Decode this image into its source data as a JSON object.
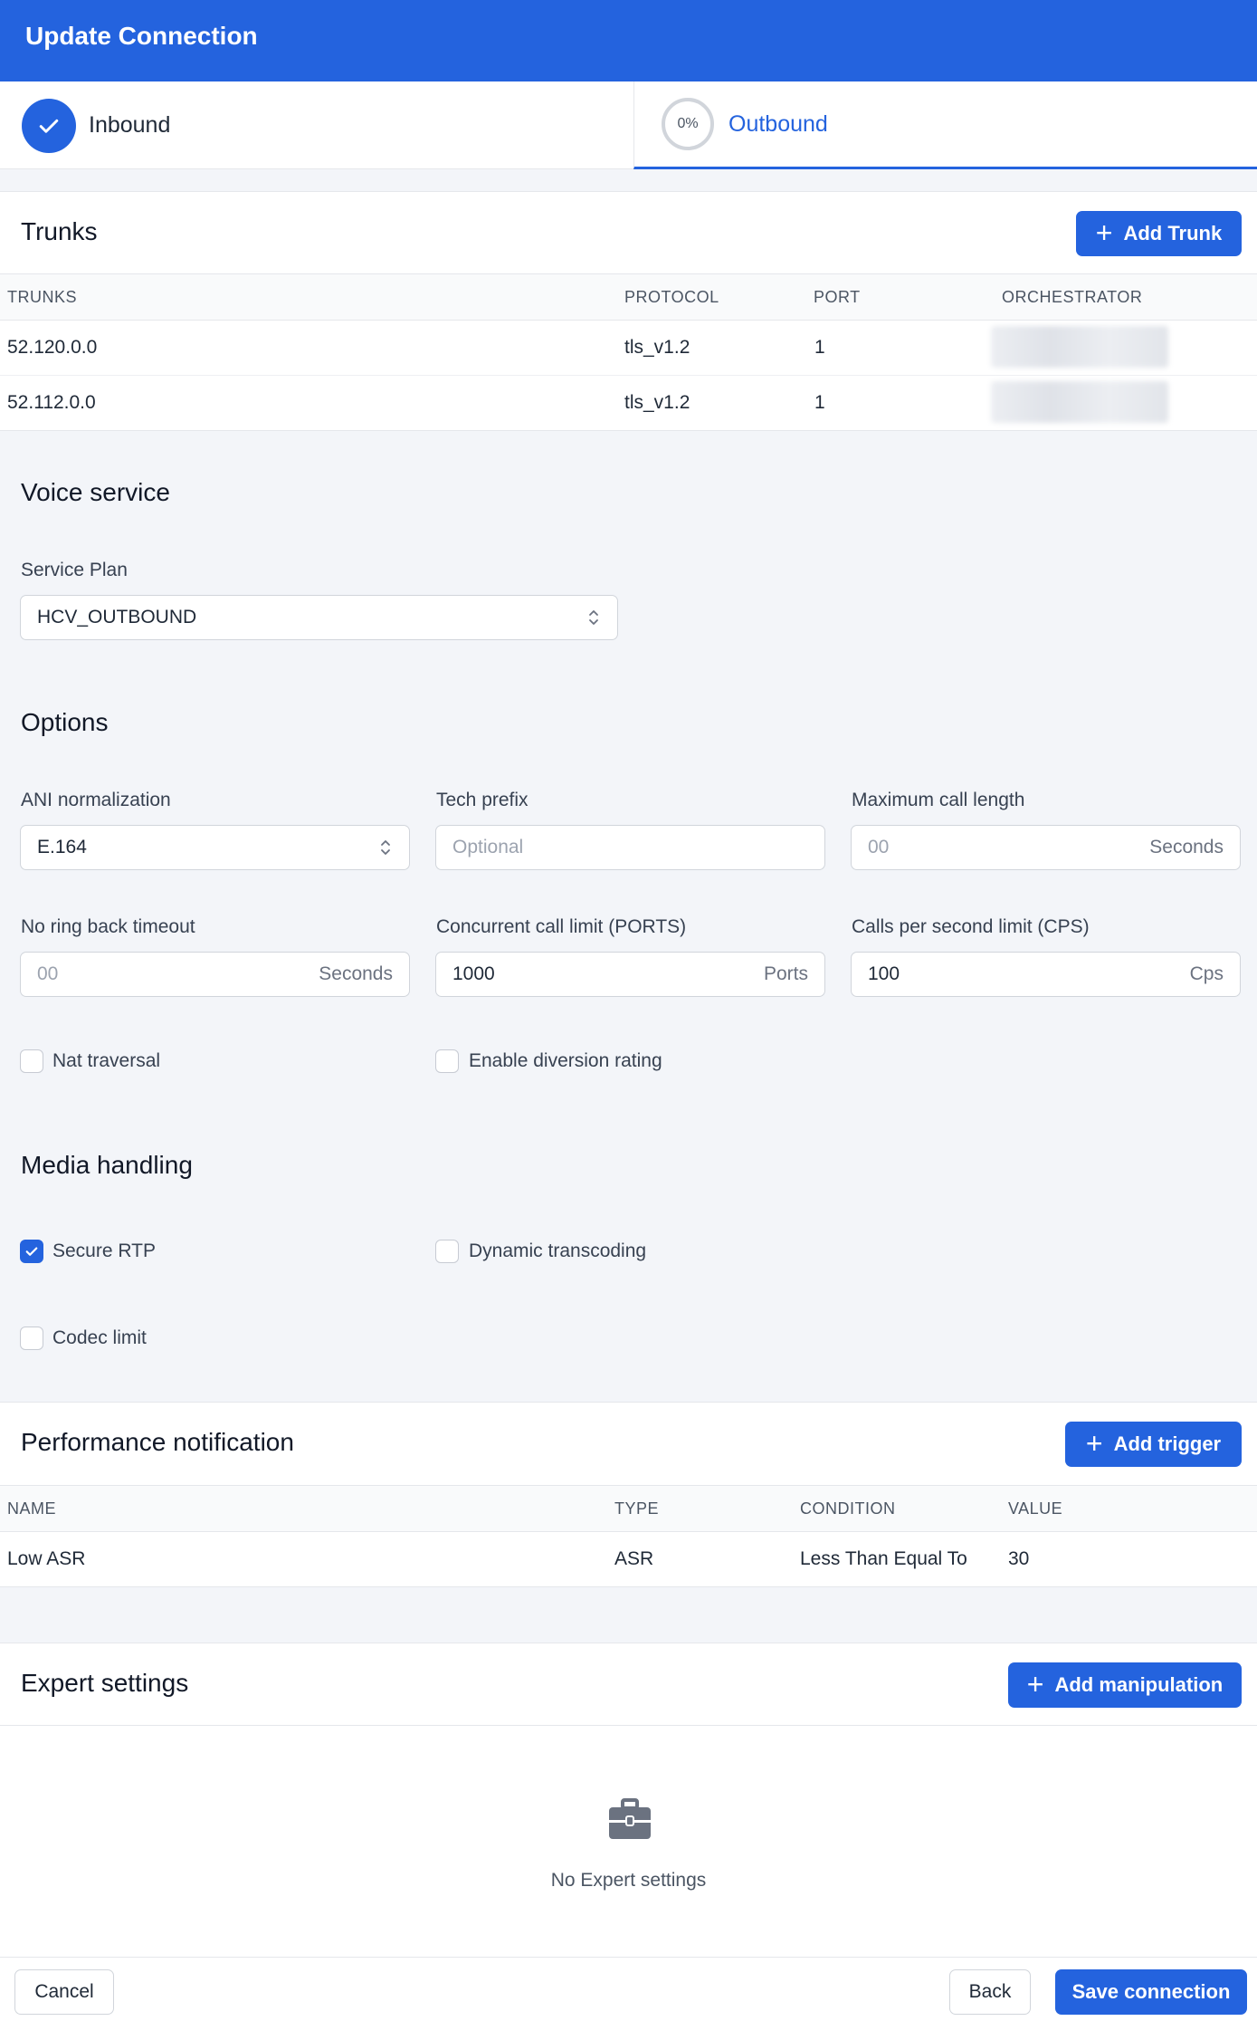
{
  "header": {
    "title": "Update Connection"
  },
  "steps": [
    {
      "label": "Inbound",
      "state": "complete"
    },
    {
      "label": "Outbound",
      "progress": "0%",
      "state": "active"
    }
  ],
  "trunks": {
    "title": "Trunks",
    "add_label": "Add Trunk",
    "columns": [
      "TRUNKS",
      "PROTOCOL",
      "PORT",
      "ORCHESTRATOR"
    ],
    "rows": [
      {
        "trunk": "52.120.0.0",
        "protocol": "tls_v1.2",
        "port": "1"
      },
      {
        "trunk": "52.112.0.0",
        "protocol": "tls_v1.2",
        "port": "1"
      }
    ]
  },
  "voice_service": {
    "title": "Voice service",
    "service_plan_label": "Service Plan",
    "service_plan_value": "HCV_OUTBOUND"
  },
  "options": {
    "title": "Options",
    "ani_label": "ANI normalization",
    "ani_value": "E.164",
    "tech_prefix_label": "Tech prefix",
    "tech_prefix_placeholder": "Optional",
    "max_call_label": "Maximum call length",
    "max_call_placeholder": "00",
    "max_call_suffix": "Seconds",
    "no_ring_label": "No ring back timeout",
    "no_ring_placeholder": "00",
    "no_ring_suffix": "Seconds",
    "concurrent_label": "Concurrent call limit (PORTS)",
    "concurrent_value": "1000",
    "concurrent_suffix": "Ports",
    "cps_label": "Calls per second limit (CPS)",
    "cps_value": "100",
    "cps_suffix": "Cps",
    "nat_label": "Nat traversal",
    "diversion_label": "Enable diversion rating"
  },
  "media": {
    "title": "Media handling",
    "secure_rtp_label": "Secure RTP",
    "dynamic_label": "Dynamic transcoding",
    "codec_label": "Codec limit"
  },
  "performance": {
    "title": "Performance notification",
    "add_label": "Add trigger",
    "columns": [
      "NAME",
      "TYPE",
      "CONDITION",
      "VALUE"
    ],
    "rows": [
      {
        "name": "Low ASR",
        "type": "ASR",
        "condition": "Less Than Equal To",
        "value": "30"
      }
    ]
  },
  "expert": {
    "title": "Expert settings",
    "add_label": "Add manipulation",
    "empty_text": "No Expert settings"
  },
  "footer": {
    "cancel_label": "Cancel",
    "back_label": "Back",
    "save_label": "Save connection"
  },
  "colors": {
    "primary": "#2463de",
    "background": "#f3f5f9"
  }
}
